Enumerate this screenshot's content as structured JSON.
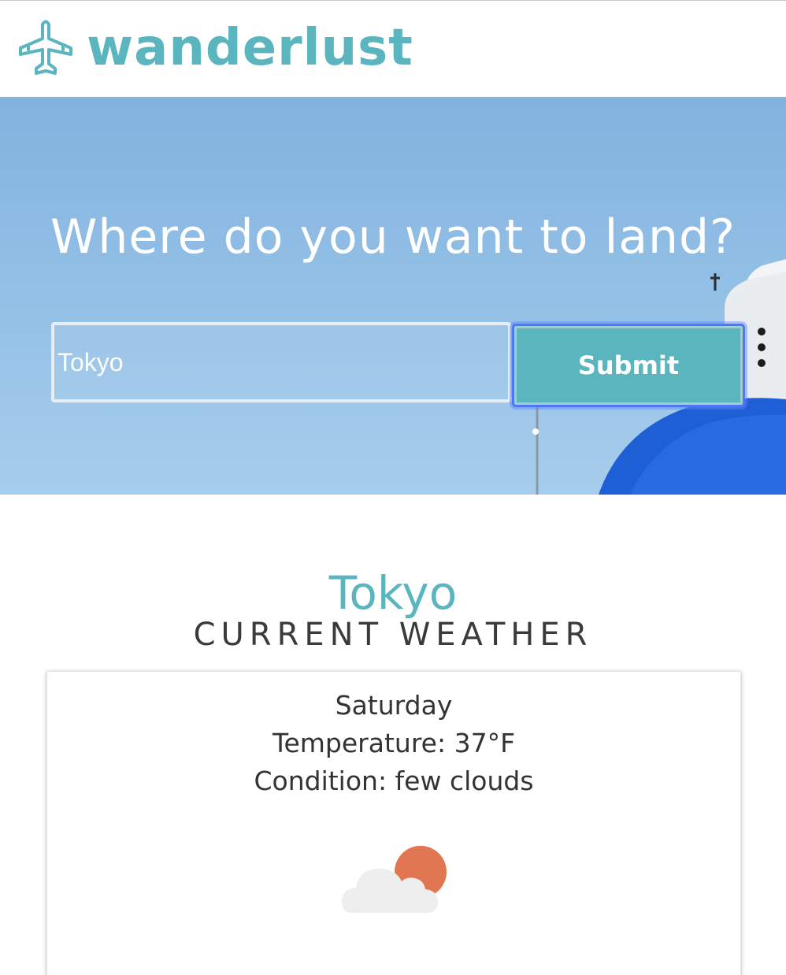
{
  "brand": {
    "name": "wanderlust",
    "icon": "airplane-icon",
    "color": "#5ab5bf"
  },
  "hero": {
    "headline": "Where do you want to land?",
    "search_value": "Tokyo",
    "submit_label": "Submit"
  },
  "weather": {
    "city": "Tokyo",
    "subtitle": "CURRENT WEATHER",
    "day": "Saturday",
    "temperature": "Temperature: 37°F",
    "condition": "Condition: few clouds",
    "icon": "few-clouds-icon"
  },
  "colors": {
    "accent": "#5ab5bf",
    "sky": "#93c0e6",
    "dome": "#1f5fd6",
    "sun": "#e07752",
    "cloud": "#eeeeee",
    "text": "#333333"
  }
}
